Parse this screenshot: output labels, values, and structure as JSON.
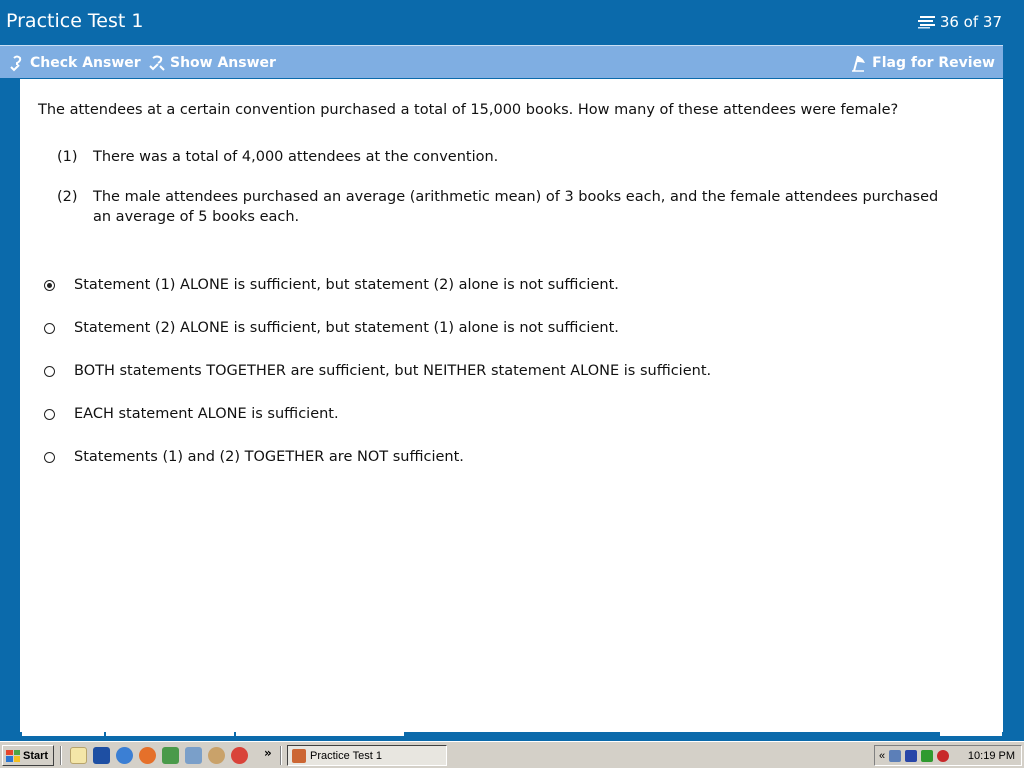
{
  "window": {
    "title": "Practice Test 1",
    "progress": "36 of 37"
  },
  "toolbar": {
    "check_answer": "Check Answer",
    "show_answer": "Show Answer",
    "flag_for_review": "Flag for Review"
  },
  "question": {
    "stem": "The attendees at a certain convention purchased a total of 15,000 books.  How many of these attendees were female?",
    "statements": [
      {
        "num": "(1)",
        "text": "There was a total of 4,000 attendees at the convention."
      },
      {
        "num": "(2)",
        "text": "The male attendees purchased an average (arithmetic mean) of 3 books each, and the female attendees purchased an average of 5 books each."
      }
    ],
    "options": [
      "Statement (1) ALONE is sufficient, but statement (2) alone is not sufficient.",
      "Statement (2) ALONE is sufficient, but statement (1) alone is not sufficient.",
      "BOTH statements TOGETHER are sufficient, but NEITHER statement ALONE is sufficient.",
      "EACH statement ALONE is sufficient.",
      "Statements (1) and (2) TOGETHER are NOT sufficient."
    ],
    "selected_option": 0
  },
  "taskbar": {
    "start_label": "Start",
    "task_button": "Practice Test 1",
    "overflow": "»",
    "tray_expand": "«",
    "clock": "10:19 PM"
  },
  "colors": {
    "title_bg": "#0b6aab",
    "toolbar_bg": "#7faee2",
    "taskbar_bg": "#d4d0c8"
  }
}
